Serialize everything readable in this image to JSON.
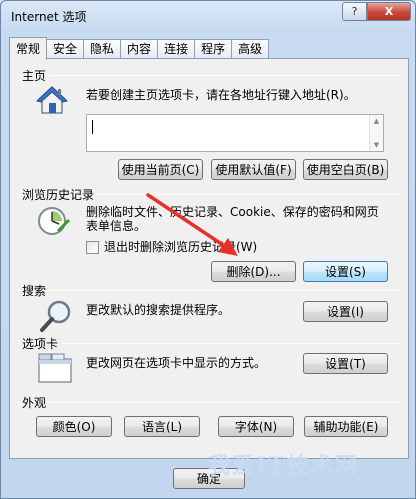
{
  "window": {
    "title": "Internet 选项",
    "help_label": "?",
    "close_label": "X"
  },
  "tabs": [
    {
      "label": "常规",
      "active": true
    },
    {
      "label": "安全"
    },
    {
      "label": "隐私"
    },
    {
      "label": "内容"
    },
    {
      "label": "连接"
    },
    {
      "label": "程序"
    },
    {
      "label": "高级"
    }
  ],
  "homepage": {
    "title": "主页",
    "description": "若要创建主页选项卡，请在各地址行键入地址(R)。",
    "url_value": "",
    "buttons": {
      "use_current": "使用当前页(C)",
      "use_default": "使用默认值(F)",
      "use_blank": "使用空白页(B)"
    }
  },
  "history": {
    "title": "浏览历史记录",
    "description_line1": "删除临时文件、历史记录、Cookie、保存的密码和网页",
    "description_line2": "表单信息。",
    "checkbox_label": "退出时删除浏览历史记录(W)",
    "checkbox_checked": false,
    "buttons": {
      "delete": "删除(D)...",
      "settings": "设置(S)"
    }
  },
  "search": {
    "title": "搜索",
    "description": "更改默认的搜索提供程序。",
    "settings_label": "设置(I)"
  },
  "tabs_section": {
    "title": "选项卡",
    "description": "更改网页在选项卡中显示的方式。",
    "settings_label": "设置(T)"
  },
  "appearance": {
    "title": "外观",
    "buttons": {
      "colors": "颜色(O)",
      "languages": "语言(L)",
      "fonts": "字体(N)",
      "accessibility": "辅助功能(E)"
    }
  },
  "footer": {
    "ok_label": "确定"
  },
  "watermark": "我爱IT技术网",
  "colors": {
    "annotation_arrow": "#e8302a",
    "close_button": "#c9463a",
    "focus_border": "#3c7fb1"
  }
}
